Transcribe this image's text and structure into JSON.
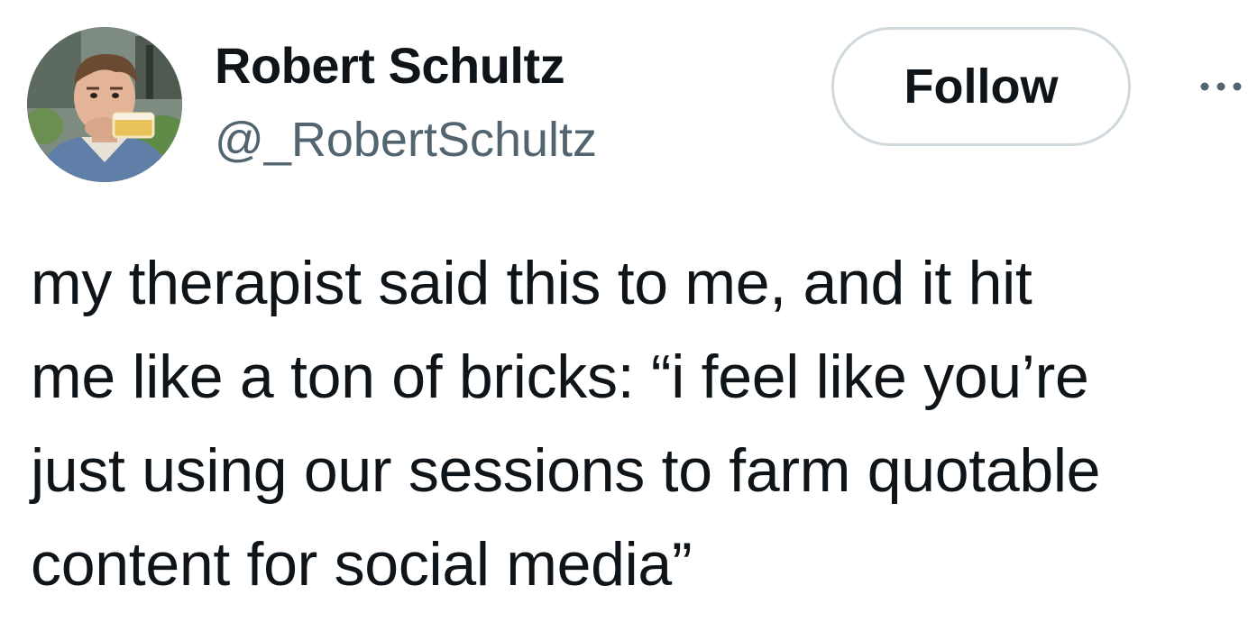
{
  "author": {
    "display_name": "Robert Schultz",
    "handle": "@_RobertSchultz",
    "avatar_icon": "profile-photo"
  },
  "actions": {
    "follow_label": "Follow",
    "more_icon": "ellipsis-horizontal-icon"
  },
  "tweet": {
    "text": "my therapist said this to me, and it hit\nme like a ton of bricks: “i feel like you’re\njust using our sessions to farm quotable\ncontent for social media”"
  },
  "colors": {
    "text_primary": "#0f1419",
    "text_secondary": "#536471",
    "button_border": "#cfd9de",
    "background": "#ffffff"
  }
}
